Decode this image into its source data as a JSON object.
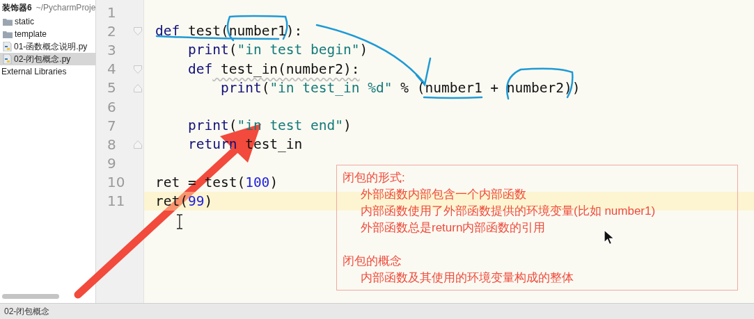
{
  "sidebar": {
    "project": {
      "name": "装饰器6",
      "path": "~/PycharmProje"
    },
    "items": [
      {
        "kind": "folder",
        "label": "static",
        "selected": false
      },
      {
        "kind": "folder",
        "label": "template",
        "selected": false
      },
      {
        "kind": "python",
        "label": "01-函数概念说明.py",
        "selected": false
      },
      {
        "kind": "python",
        "label": "02-闭包概念.py",
        "selected": true
      },
      {
        "kind": "library",
        "label": "External Libraries",
        "selected": false
      }
    ]
  },
  "editor": {
    "lines": [
      {
        "number": "1",
        "current": false,
        "fold_start": false,
        "fold_end": false
      },
      {
        "number": "2",
        "current": false,
        "fold_start": true,
        "fold_end": false,
        "tokens": [
          {
            "kind": "keyword",
            "text": "def"
          },
          {
            "kind": "plain",
            "text": " test(number1):"
          }
        ]
      },
      {
        "number": "3",
        "current": false,
        "fold_start": false,
        "fold_end": false,
        "tokens": [
          {
            "kind": "keyword",
            "text": "    print"
          },
          {
            "kind": "plain",
            "text": "("
          },
          {
            "kind": "string",
            "text": "\"in test begin\""
          },
          {
            "kind": "plain",
            "text": ")"
          }
        ]
      },
      {
        "number": "4",
        "current": false,
        "fold_start": true,
        "fold_end": false,
        "tokens": [
          {
            "kind": "keyword",
            "text": "    def"
          },
          {
            "kind": "plain",
            "text": " test_in(number2):",
            "warning": true
          }
        ]
      },
      {
        "number": "5",
        "current": false,
        "fold_start": false,
        "fold_end": true,
        "tokens": [
          {
            "kind": "keyword",
            "text": "        print"
          },
          {
            "kind": "plain",
            "text": "("
          },
          {
            "kind": "string",
            "text": "\"in test_in %d\""
          },
          {
            "kind": "plain",
            "text": " % (number1 + number2))"
          }
        ]
      },
      {
        "number": "6",
        "current": false,
        "fold_start": false,
        "fold_end": false
      },
      {
        "number": "7",
        "current": false,
        "fold_start": false,
        "fold_end": false,
        "tokens": [
          {
            "kind": "keyword",
            "text": "    print"
          },
          {
            "kind": "plain",
            "text": "("
          },
          {
            "kind": "string",
            "text": "\"in test end\""
          },
          {
            "kind": "plain",
            "text": ")"
          }
        ]
      },
      {
        "number": "8",
        "current": false,
        "fold_start": false,
        "fold_end": true,
        "tokens": [
          {
            "kind": "keyword",
            "text": "    return"
          },
          {
            "kind": "plain",
            "text": " test_in"
          }
        ]
      },
      {
        "number": "9",
        "current": false,
        "fold_start": false,
        "fold_end": false
      },
      {
        "number": "10",
        "current": false,
        "fold_start": false,
        "fold_end": false,
        "tokens": [
          {
            "kind": "plain",
            "text": "ret = test("
          },
          {
            "kind": "number",
            "text": "100"
          },
          {
            "kind": "plain",
            "text": ")"
          }
        ]
      },
      {
        "number": "11",
        "current": true,
        "fold_start": false,
        "fold_end": false,
        "tokens": [
          {
            "kind": "plain",
            "text": "ret("
          },
          {
            "kind": "number",
            "text": "99"
          },
          {
            "kind": "plain",
            "text": ")"
          }
        ]
      }
    ],
    "note": {
      "sections": [
        {
          "heading": "闭包的形式:",
          "items": [
            "外部函数内部包含一个内部函数",
            "内部函数使用了外部函数提供的环境变量(比如 number1)",
            "外部函数总是return内部函数的引用"
          ]
        },
        {
          "heading": "闭包的概念",
          "items": [
            "内部函数及其使用的环境变量构成的整体"
          ]
        }
      ]
    }
  },
  "status_bar": {
    "text": "02-闭包概念"
  }
}
